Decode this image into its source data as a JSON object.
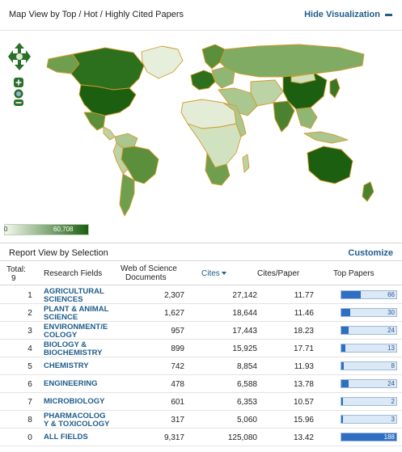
{
  "map_section": {
    "title": "Map View by Top / Hot / Highly Cited Papers",
    "hide_label": "Hide Visualization",
    "legend_min": "0",
    "legend_max": "60,708",
    "colors": {
      "land_light": "#e3ecd7",
      "land_dark": "#1c5f10",
      "border": "#d39a2a"
    }
  },
  "report_section": {
    "title": "Report View by Selection",
    "customize_label": "Customize"
  },
  "table": {
    "headers": {
      "total_label": "Total:",
      "total_value": "9",
      "field": "Research Fields",
      "docs_line1": "Web of Science",
      "docs_line2": "Documents",
      "cites": "Cites",
      "cpp": "Cites/Paper",
      "top": "Top Papers"
    },
    "max_top_papers": 188,
    "rows": [
      {
        "num": "1",
        "field_line1": "AGRICULTURAL",
        "field_line2": "SCIENCES",
        "docs": "2,307",
        "cites": "27,142",
        "cpp": "11.77",
        "top": "66",
        "top_value": 66
      },
      {
        "num": "2",
        "field_line1": "PLANT & ANIMAL",
        "field_line2": "SCIENCE",
        "docs": "1,627",
        "cites": "18,644",
        "cpp": "11.46",
        "top": "30",
        "top_value": 30
      },
      {
        "num": "3",
        "field_line1": "ENVIRONMENT/E",
        "field_line2": "COLOGY",
        "docs": "957",
        "cites": "17,443",
        "cpp": "18.23",
        "top": "24",
        "top_value": 24
      },
      {
        "num": "4",
        "field_line1": "BIOLOGY &",
        "field_line2": "BIOCHEMISTRY",
        "docs": "899",
        "cites": "15,925",
        "cpp": "17.71",
        "top": "13",
        "top_value": 13
      },
      {
        "num": "5",
        "field_line1": "CHEMISTRY",
        "field_line2": "",
        "docs": "742",
        "cites": "8,854",
        "cpp": "11.93",
        "top": "8",
        "top_value": 8
      },
      {
        "num": "6",
        "field_line1": "ENGINEERING",
        "field_line2": "",
        "docs": "478",
        "cites": "6,588",
        "cpp": "13.78",
        "top": "24",
        "top_value": 24
      },
      {
        "num": "7",
        "field_line1": "MICROBIOLOGY",
        "field_line2": "",
        "docs": "601",
        "cites": "6,353",
        "cpp": "10.57",
        "top": "2",
        "top_value": 2
      },
      {
        "num": "8",
        "field_line1": "PHARMACOLOG",
        "field_line2": "Y & TOXICOLOGY",
        "docs": "317",
        "cites": "5,060",
        "cpp": "15.96",
        "top": "3",
        "top_value": 3
      },
      {
        "num": "0",
        "field_line1": "ALL FIELDS",
        "field_line2": "",
        "docs": "9,317",
        "cites": "125,080",
        "cpp": "13.42",
        "top": "188",
        "top_value": 188
      }
    ]
  }
}
